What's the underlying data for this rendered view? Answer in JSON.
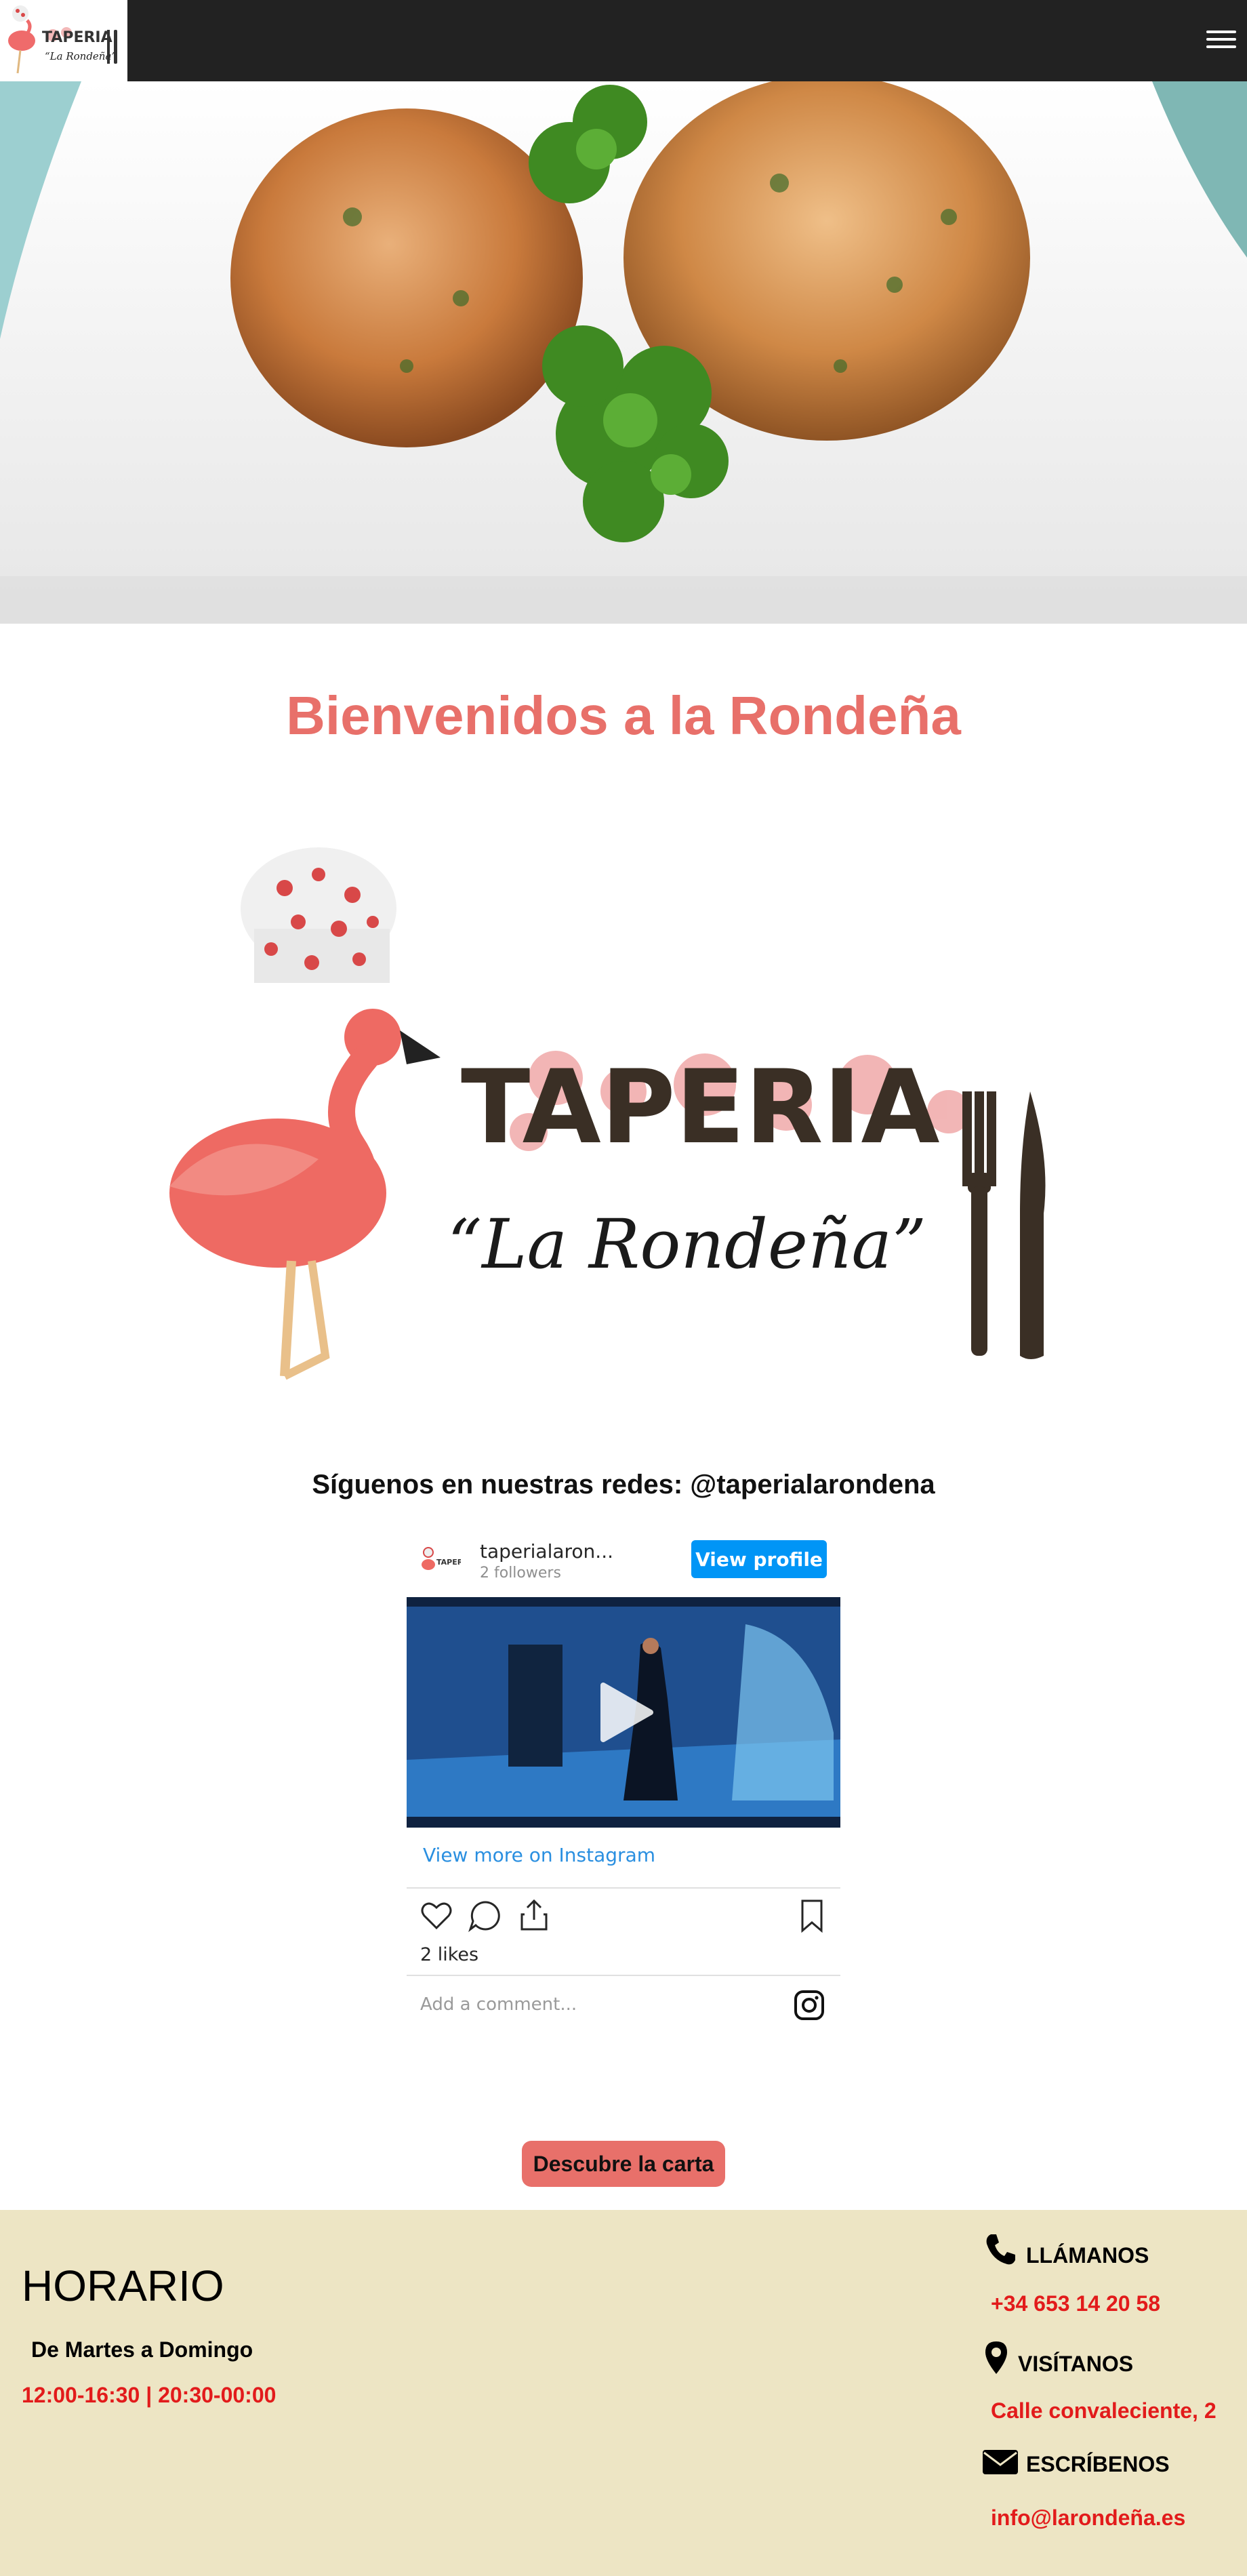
{
  "header": {
    "logo_alt": "Taperia La Rondeña logo",
    "logo_word": "TAPERIA",
    "logo_script": "“La Rondeña”",
    "menu_icon": "hamburger-menu-icon"
  },
  "hero": {
    "image_alt": "Croquetas con perejil"
  },
  "welcome": {
    "title": "Bienvenidos a la Rondeña"
  },
  "brand_logo": {
    "word": "TAPERIA",
    "script": "“La Rondeña”"
  },
  "social": {
    "heading": "Síguenos en nuestras redes: @taperialarondena",
    "instagram": {
      "username": "taperialaron...",
      "followers": "2 followers",
      "view_profile": "View profile",
      "view_more": "View more on Instagram",
      "likes": "2 likes",
      "comment_placeholder": "Add a comment...",
      "icons": [
        "heart-icon",
        "comment-icon",
        "share-icon",
        "bookmark-icon",
        "instagram-icon",
        "play-icon"
      ]
    }
  },
  "cta": {
    "label": "Descubre la carta"
  },
  "footer": {
    "hours": {
      "title": "HORARIO",
      "days": "De Martes a Domingo",
      "time": "12:00-16:30 | 20:30-00:00"
    },
    "contact": [
      {
        "icon": "phone-icon",
        "label": "LLÁMANOS",
        "value": "+34 653 14 20 58"
      },
      {
        "icon": "map-marker-icon",
        "label": "VISÍTANOS",
        "value": "Calle convaleciente, 2"
      },
      {
        "icon": "envelope-icon",
        "label": "ESCRÍBENOS",
        "value": "info@larondeña.es"
      }
    ],
    "colors": {
      "background": "#ede5c4",
      "accent": "#e21b1b"
    }
  },
  "colors": {
    "topbar": "#222222",
    "brand_coral": "#e8706a",
    "instagram_blue": "#0095f6"
  }
}
